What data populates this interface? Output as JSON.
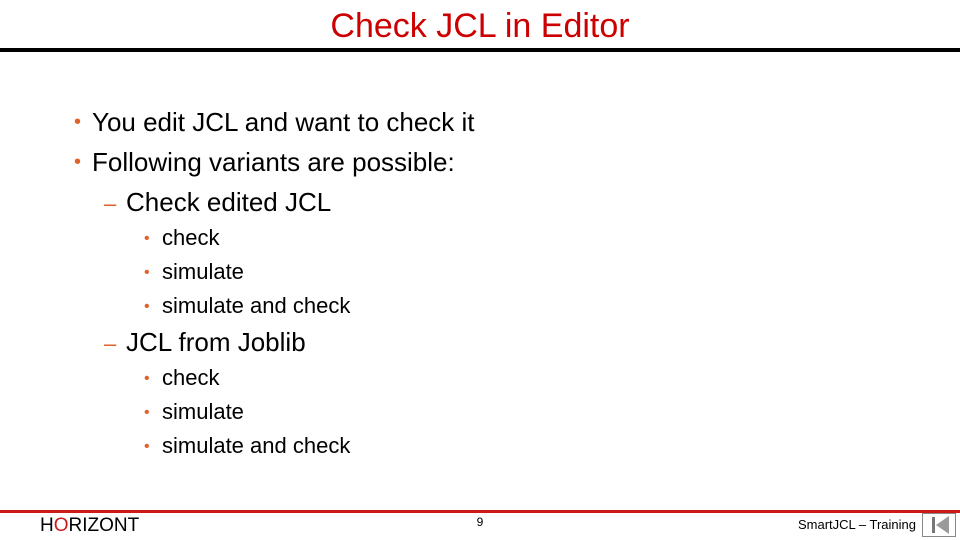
{
  "slide": {
    "title": "Check JCL in Editor",
    "bullets": [
      "You edit JCL and want to check it",
      "Following variants are possible:"
    ],
    "sections": [
      {
        "label": "Check edited JCL",
        "items": [
          "check",
          "simulate",
          "simulate and check"
        ]
      },
      {
        "label": "JCL from Joblib",
        "items": [
          "check",
          "simulate",
          "simulate and check"
        ]
      }
    ]
  },
  "footer": {
    "logo_pre": "H",
    "logo_o": "O",
    "logo_post": "RIZONT",
    "page_number": "9",
    "course": "SmartJCL – Training",
    "nav_icon": "first-slide-icon"
  },
  "colors": {
    "title": "#cc0000",
    "bullet": "#e0622b",
    "footer_rule": "#cc1a1a"
  }
}
